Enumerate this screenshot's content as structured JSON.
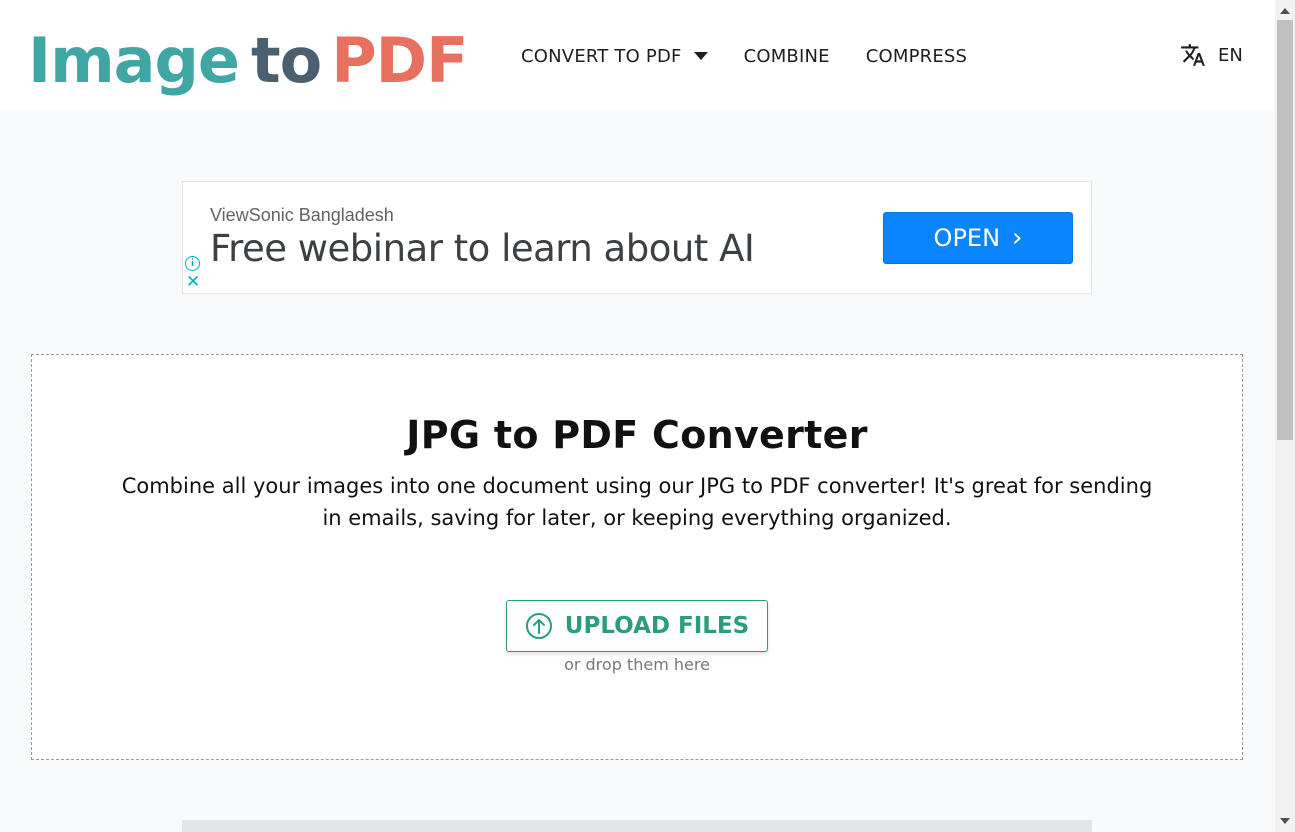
{
  "logo": {
    "image": "Image",
    "to": "to",
    "pdf": "PDF"
  },
  "nav": {
    "items": [
      {
        "label": "CONVERT TO PDF",
        "has_dropdown": true
      },
      {
        "label": "COMBINE"
      },
      {
        "label": "COMPRESS"
      }
    ],
    "language": {
      "icon": "translate-icon",
      "code": "EN"
    }
  },
  "ad": {
    "advertiser": "ViewSonic Bangladesh",
    "headline": "Free webinar to learn about AI",
    "cta": "OPEN",
    "cta_color": "#0a84ff"
  },
  "converter": {
    "title": "JPG to PDF Converter",
    "description": "Combine all your images into one document using our JPG to PDF converter! It's great for sending in emails, saving for later, or keeping everything organized.",
    "upload_label": "UPLOAD FILES",
    "drop_hint": "or drop them here",
    "accent_color": "#2a9d7d"
  },
  "colors": {
    "logo_teal": "#3fa6a3",
    "logo_slate": "#4a6070",
    "logo_coral": "#e8705f"
  }
}
